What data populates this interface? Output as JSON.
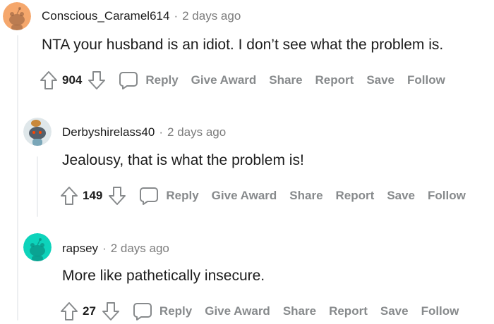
{
  "comments": [
    {
      "author": "Conscious_Caramel614",
      "separator": "·",
      "time": "2 days ago",
      "body": "NTA your husband is an idiot. I don’t see what the problem is.",
      "votes": "904",
      "actions": [
        "Reply",
        "Give Award",
        "Share",
        "Report",
        "Save",
        "Follow"
      ],
      "avatar_color": "#f5a76c"
    },
    {
      "author": "Derbyshirelass40",
      "separator": "·",
      "time": "2 days ago",
      "body": "Jealousy, that is what the problem is!",
      "votes": "149",
      "actions": [
        "Reply",
        "Give Award",
        "Share",
        "Report",
        "Save",
        "Follow"
      ],
      "avatar_color": "#dfe7ea"
    },
    {
      "author": "rapsey",
      "separator": "·",
      "time": "2 days ago",
      "body": "More like pathetically insecure.",
      "votes": "27",
      "actions": [
        "Reply",
        "Give Award",
        "Share",
        "Report",
        "Save",
        "Follow"
      ],
      "avatar_color": "#0dd3bb"
    }
  ]
}
